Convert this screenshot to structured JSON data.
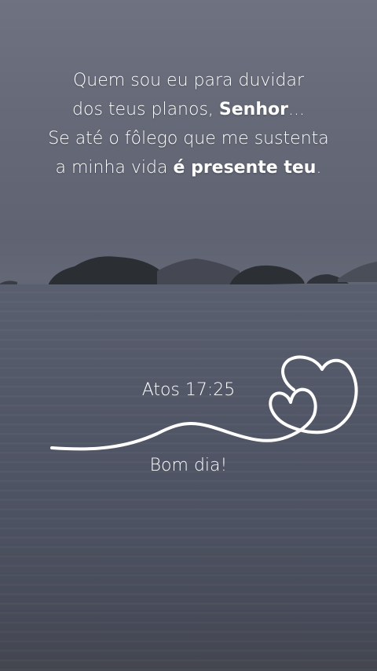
{
  "quote": {
    "line1": "Quem sou eu para duvidar",
    "line2_pre": "dos teus planos, ",
    "line2_bold": "Senhor",
    "line2_post": "...",
    "line3": "Se até o fôlego que me sustenta",
    "line4_pre": "a minha vida ",
    "line4_bold": "é presente teu",
    "line4_post": "."
  },
  "reference": "Atos 17:25",
  "greeting": "Bom dia!",
  "colors": {
    "text": "#ffffff",
    "sky": "#6a6e7c",
    "sea": "#4d5262",
    "islands": "#2c2f33"
  },
  "icons": [
    "heart-line-ornament-icon"
  ]
}
